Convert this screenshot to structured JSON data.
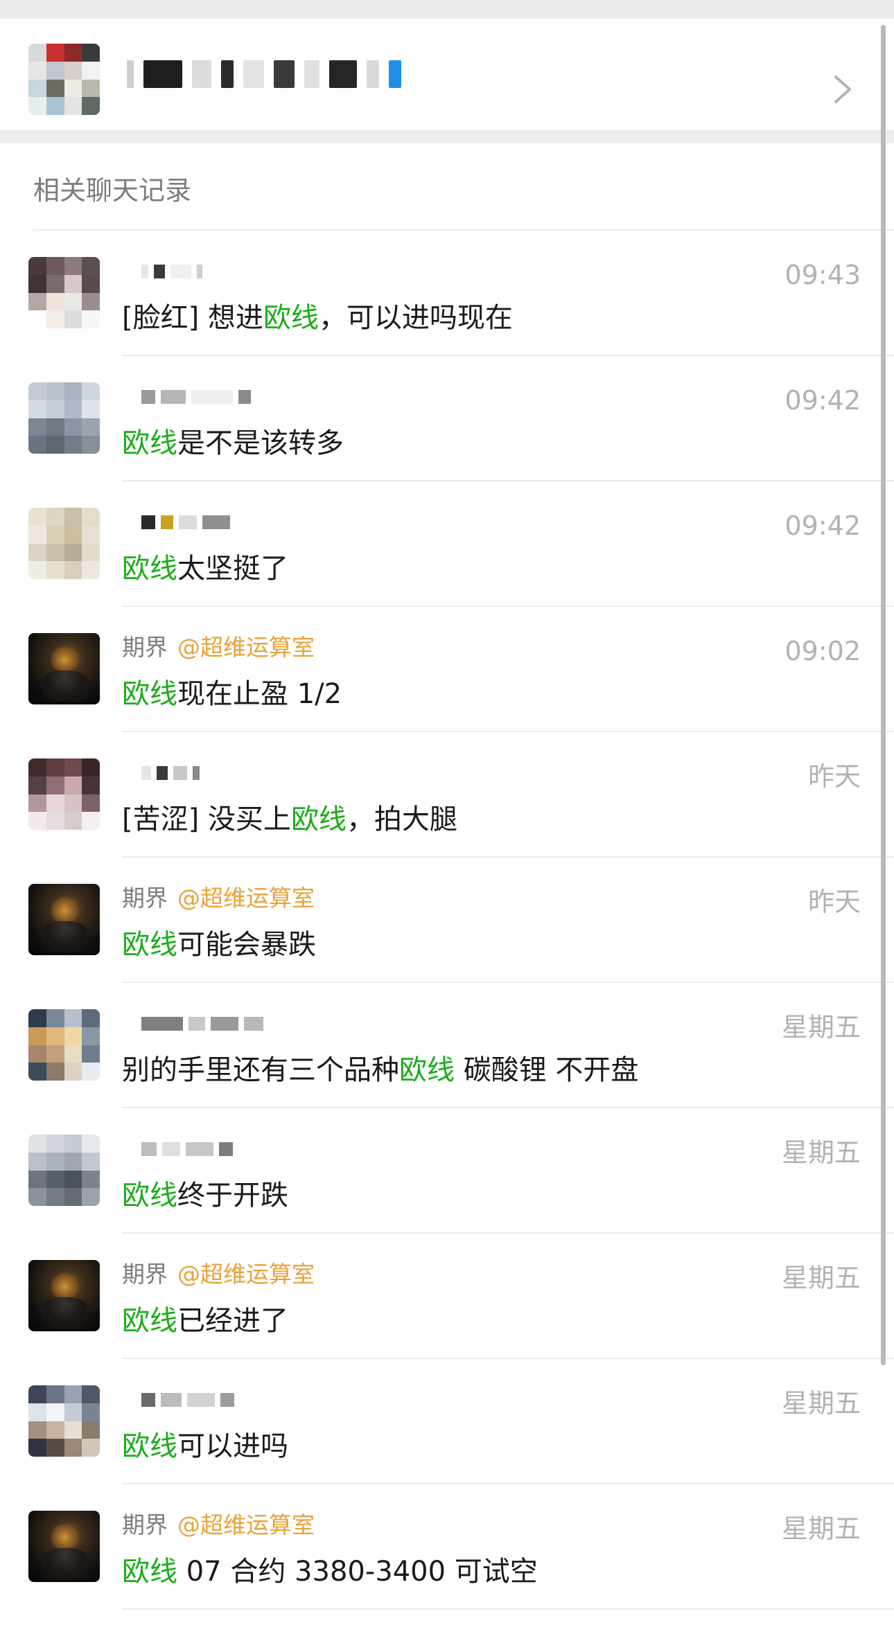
{
  "colors": {
    "keyword": "#1aad19",
    "mention": "#e8a23a",
    "time": "#b2b2b2",
    "secondary_text": "#7d7d7d",
    "primary_text": "#1a1a1a",
    "page_bg": "#ededed"
  },
  "group": {
    "name": "",
    "chevron_icon": "chevron-right-icon"
  },
  "section_title": "相关聊天记录",
  "results": [
    {
      "sender": "",
      "mention": "",
      "time": "09:43",
      "before": "[脸红] 想进",
      "keyword": "欧线",
      "after": "，可以进吗现在"
    },
    {
      "sender": "",
      "mention": "",
      "time": "09:42",
      "before": "",
      "keyword": "欧线",
      "after": "是不是该转多"
    },
    {
      "sender": "",
      "mention": "",
      "time": "09:42",
      "before": "",
      "keyword": "欧线",
      "after": "太坚挺了"
    },
    {
      "sender": "期界",
      "mention": "@超维运算室",
      "time": "09:02",
      "before": "",
      "keyword": "欧线",
      "after": "现在止盈 1/2"
    },
    {
      "sender": "",
      "mention": "",
      "time": "昨天",
      "before": "[苦涩] 没买上",
      "keyword": "欧线",
      "after": "，拍大腿"
    },
    {
      "sender": "期界",
      "mention": "@超维运算室",
      "time": "昨天",
      "before": "",
      "keyword": "欧线",
      "after": "可能会暴跌"
    },
    {
      "sender": "",
      "mention": "",
      "time": "星期五",
      "before": "别的手里还有三个品种",
      "keyword": "欧线",
      "after": " 碳酸锂 不开盘"
    },
    {
      "sender": "",
      "mention": "",
      "time": "星期五",
      "before": "",
      "keyword": "欧线",
      "after": "终于开跌"
    },
    {
      "sender": "期界",
      "mention": "@超维运算室",
      "time": "星期五",
      "before": "",
      "keyword": "欧线",
      "after": "已经进了"
    },
    {
      "sender": "",
      "mention": "",
      "time": "星期五",
      "before": "",
      "keyword": "欧线",
      "after": "可以进吗"
    },
    {
      "sender": "期界",
      "mention": "@超维运算室",
      "time": "星期五",
      "before": "",
      "keyword": "欧线",
      "after": " 07 合约 3380-3400 可试空"
    }
  ]
}
